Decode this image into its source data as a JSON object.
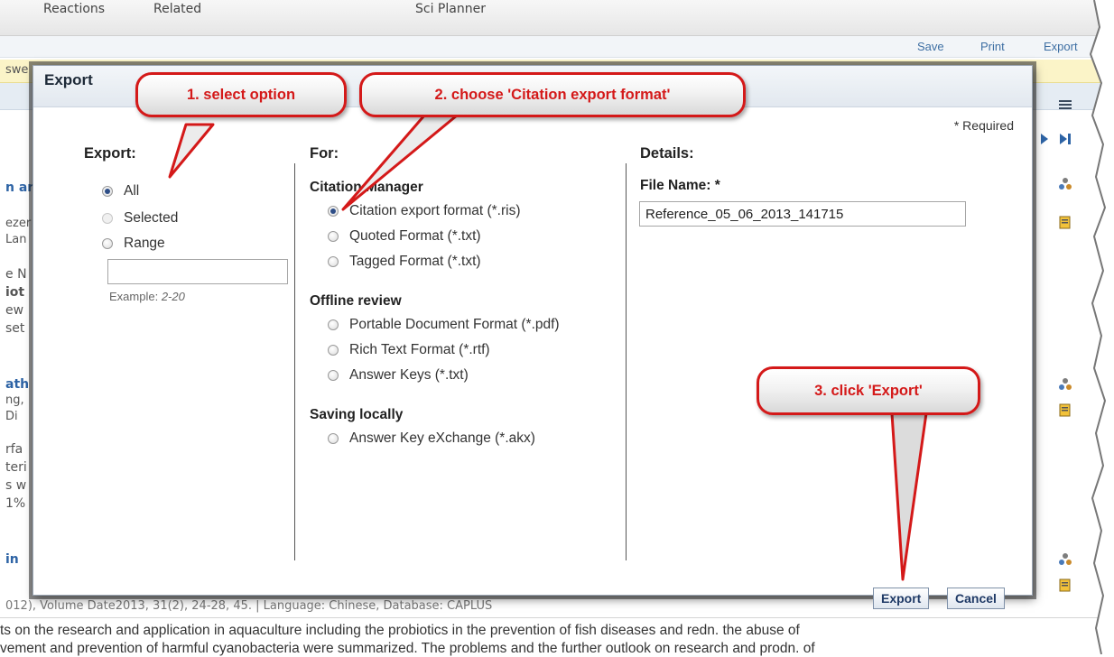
{
  "background": {
    "tabs": [
      "Reactions",
      "Related",
      "Sci Planner"
    ],
    "actions": [
      "Save",
      "Print",
      "Export"
    ],
    "yellow_fragment": "swe",
    "left_fragments": [
      "n ar",
      "ezer",
      "Lan",
      "e N",
      "iot",
      "ew",
      "set",
      "ath",
      "ng,",
      "Di",
      "rfa",
      "teri",
      "s w",
      "1%",
      "in"
    ],
    "citation_fragment": "012), Volume Date2013, 31(2), 24-28, 45. | Language: Chinese, Database: CAPLUS",
    "abstract_line1": "ts on the research and application in aquaculture including the probiotics in the prevention of fish diseases and redn. the abuse of",
    "abstract_line2": "vement and prevention of harmful cyanobacteria were summarized.  The problems and the further outlook on research and prodn. of"
  },
  "dialog": {
    "title": "Export",
    "required_note": "* Required",
    "export_col": {
      "heading": "Export:",
      "options": [
        {
          "label": "All",
          "checked": true
        },
        {
          "label": "Selected",
          "checked": false,
          "disabled": true
        },
        {
          "label": "Range",
          "checked": false
        }
      ],
      "range_value": "",
      "example_label": "Example: ",
      "example_value": "2-20"
    },
    "for_col": {
      "heading": "For:",
      "groups": [
        {
          "name": "Citation Manager",
          "options": [
            {
              "label": "Citation export format (*.ris)",
              "checked": true
            },
            {
              "label": "Quoted Format (*.txt)",
              "checked": false
            },
            {
              "label": "Tagged Format (*.txt)",
              "checked": false
            }
          ]
        },
        {
          "name": "Offline review",
          "options": [
            {
              "label": "Portable Document Format (*.pdf)",
              "checked": false
            },
            {
              "label": "Rich Text Format (*.rtf)",
              "checked": false
            },
            {
              "label": "Answer Keys (*.txt)",
              "checked": false
            }
          ]
        },
        {
          "name": "Saving locally",
          "options": [
            {
              "label": "Answer Key eXchange (*.akx)",
              "checked": false
            }
          ]
        }
      ]
    },
    "details_col": {
      "heading": "Details:",
      "file_name_label": "File Name: *",
      "file_name_value": "Reference_05_06_2013_141715"
    },
    "buttons": {
      "export": "Export",
      "cancel": "Cancel"
    }
  },
  "callouts": {
    "c1": "1. select option",
    "c2": "2. choose 'Citation export format'",
    "c3": "3. click 'Export'"
  },
  "colors": {
    "callout_red": "#d41919",
    "link_blue": "#3e6fa3",
    "radio_blue": "#2e4e87"
  }
}
